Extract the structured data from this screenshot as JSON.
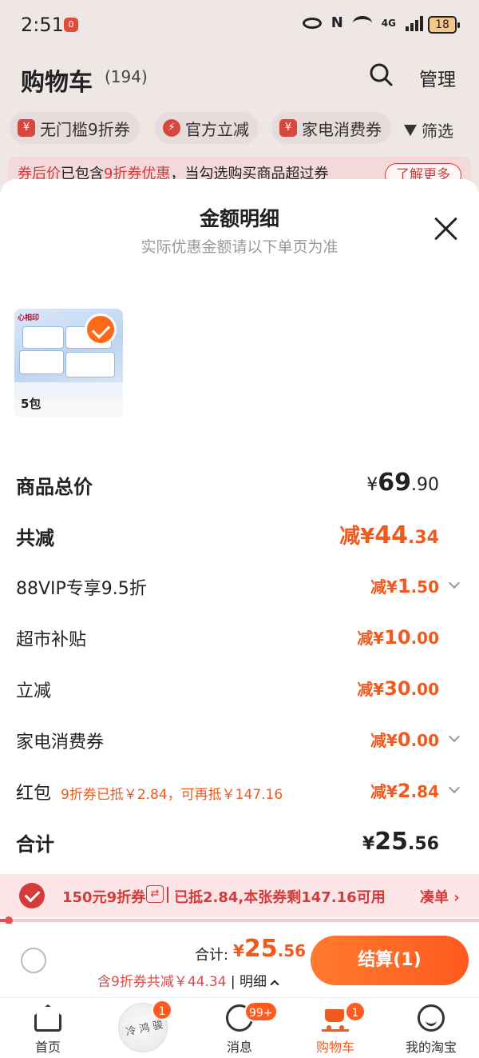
{
  "status_bar": {
    "time": "2:51",
    "notif_badge": "0",
    "network": "4G",
    "battery": "18",
    "icons": [
      "eye-icon",
      "nfc-icon",
      "wifi-icon",
      "signal-icon",
      "battery-icon"
    ]
  },
  "header": {
    "title": "购物车",
    "count": "(194)",
    "manage_label": "管理"
  },
  "chips": [
    {
      "icon": "coupon-icon",
      "icon_text": "¥",
      "label": "无门槛9折券"
    },
    {
      "icon": "bolt-icon",
      "icon_text": "⚡",
      "label": "官方立减"
    },
    {
      "icon": "coupon-icon",
      "icon_text": "¥",
      "label": "家电消费券"
    }
  ],
  "filter_label": "筛选",
  "notice": {
    "red_prefix": "券后价",
    "text_1": "已包含",
    "red_mid": "9折券优惠",
    "text_2": "，当勾选购买商品超过券",
    "button": "了解更多"
  },
  "sheet": {
    "title": "金额明细",
    "subtitle": "实际优惠金额请以下单页为准",
    "product": {
      "pack_count": "5包",
      "selected": true
    },
    "rows": {
      "total": {
        "label": "商品总价",
        "prefix": "¥",
        "int": "69",
        "dec": ".90"
      },
      "reduce": {
        "label": "共减",
        "prefix": "减¥",
        "int": "44",
        "dec": ".34"
      },
      "vip": {
        "label": "88VIP专享9.5折",
        "prefix": "减¥",
        "int": "1",
        "dec": ".50"
      },
      "subsidy": {
        "label": "超市补贴",
        "prefix": "减¥",
        "int": "10",
        "dec": ".00"
      },
      "instant": {
        "label": "立减",
        "prefix": "减¥",
        "int": "30",
        "dec": ".00"
      },
      "appliance": {
        "label": "家电消费券",
        "prefix": "减¥",
        "int": "0",
        "dec": ".00"
      },
      "redpack": {
        "label": "红包",
        "note": "9折券已抵￥2.84，可再抵￥147.16",
        "prefix": "减¥",
        "int": "2",
        "dec": ".84"
      },
      "sum": {
        "label": "合计",
        "prefix": "¥",
        "int": "25",
        "dec": ".56"
      }
    }
  },
  "coupon_strip": {
    "coupon_label": "150元9折券",
    "swap_icon": "⇄",
    "info": "已抵2.84,本张券剩147.16可用",
    "link": "凑单 ›",
    "used_fraction": 0.019
  },
  "checkout": {
    "total_label": "合计:",
    "total_prefix": "¥",
    "total_int": "25",
    "total_dec": ".56",
    "sub_text": "含9折券共减￥44.34",
    "detail_label": "明细",
    "button": "结算(1)"
  },
  "tabbar": {
    "items": [
      {
        "label": "首页",
        "icon": "home-icon"
      },
      {
        "label": "",
        "icon": "avatar-icon",
        "badge": "1",
        "avatar_text": "冷 鸿 骏"
      },
      {
        "label": "消息",
        "icon": "message-icon",
        "badge": "99+"
      },
      {
        "label": "购物车",
        "icon": "cart-icon",
        "badge": "1",
        "active": true
      },
      {
        "label": "我的淘宝",
        "icon": "smile-icon"
      }
    ]
  },
  "colors": {
    "accent": "#f05a1e",
    "coupon_red": "#d33b3b",
    "background": "#efe6e6"
  }
}
